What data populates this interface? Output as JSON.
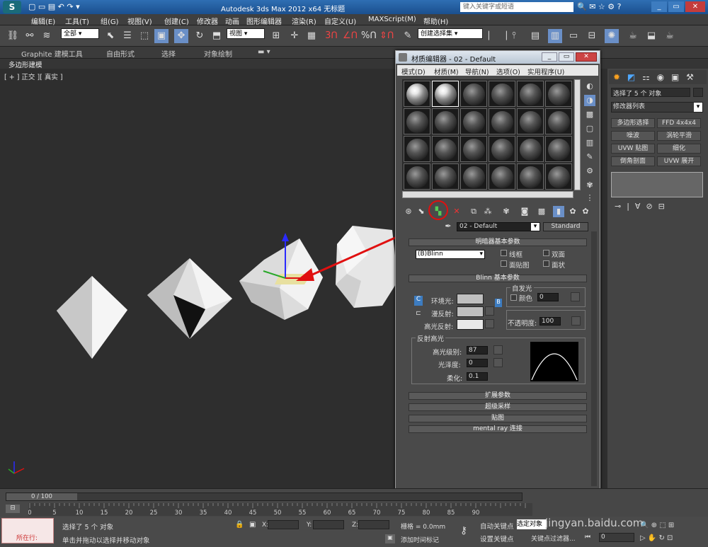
{
  "app": {
    "title": "Autodesk 3ds Max  2012 x64     无标题",
    "search_placeholder": "键入关键字或短语"
  },
  "menu": [
    "编辑(E)",
    "工具(T)",
    "组(G)",
    "视图(V)",
    "创建(C)",
    "修改器",
    "动画",
    "图形编辑器",
    "渲染(R)",
    "自定义(U)",
    "MAXScript(M)",
    "帮助(H)"
  ],
  "toolbar": {
    "selection_filter": "全部",
    "view_dropdown": "视图",
    "named_selection": "创建选择集"
  },
  "ribbon": {
    "tabs": [
      "Graphite 建模工具",
      "自由形式",
      "选择",
      "对象绘制"
    ],
    "sub": "多边形建模"
  },
  "viewport": {
    "label": "[ + ] 正交 ][ 真实 ]"
  },
  "cmd": {
    "selected": "选择了 5 个 对象",
    "modifier_list": "修改器列表",
    "buttons": [
      "多边形选择",
      "FFD 4x4x4",
      "噪波",
      "涡轮平滑",
      "UVW 贴图",
      "细化",
      "倒角剖面",
      "UVW 展开"
    ]
  },
  "mat": {
    "title": "材质编辑器 - 02 - Default",
    "menu": [
      "模式(D)",
      "材质(M)",
      "导航(N)",
      "选项(O)",
      "实用程序(U)"
    ],
    "material_name": "02 - Default",
    "material_type": "Standard",
    "shader_rollout": "明暗器基本参数",
    "shader": "(B)Blinn",
    "checks": [
      "线框",
      "双面",
      "面贴图",
      "面状"
    ],
    "blinn_rollout": "Blinn 基本参数",
    "self_illum": "自发光",
    "color_label": "颜色",
    "self_illum_value": "0",
    "ambient": "环境光:",
    "diffuse": "漫反射:",
    "specular": "高光反射:",
    "opacity_label": "不透明度:",
    "opacity": "100",
    "spec_group": "反射高光",
    "spec_level_label": "高光级别:",
    "spec_level": "87",
    "gloss_label": "光泽度:",
    "gloss": "0",
    "soften_label": "柔化:",
    "soften": "0.1",
    "rollouts": [
      "扩展参数",
      "超级采样",
      "贴图",
      "mental ray 连接"
    ]
  },
  "timeline": {
    "frame": "0 / 100",
    "ticks": [
      "0",
      "5",
      "10",
      "15",
      "20",
      "25",
      "30",
      "35",
      "40",
      "45",
      "50",
      "55",
      "60",
      "65",
      "70",
      "75",
      "80",
      "85",
      "90"
    ]
  },
  "status": {
    "selected": "选择了 5 个 对象",
    "prompt": "单击并拖动以选择并移动对象",
    "live": "所在行:",
    "grid": "栅格 = 0.0mm",
    "add_key": "添加时间标记",
    "auto_key": "自动关键点",
    "set_key": "设置关键点",
    "selected_obj": "选定对象",
    "key_filter": "关键点过滤器...",
    "frame_value": "0",
    "watermark": "jingyan.baidu.com"
  },
  "colors": {
    "accent_blue": "#2f6fb3",
    "highlight_red": "#e01010"
  }
}
